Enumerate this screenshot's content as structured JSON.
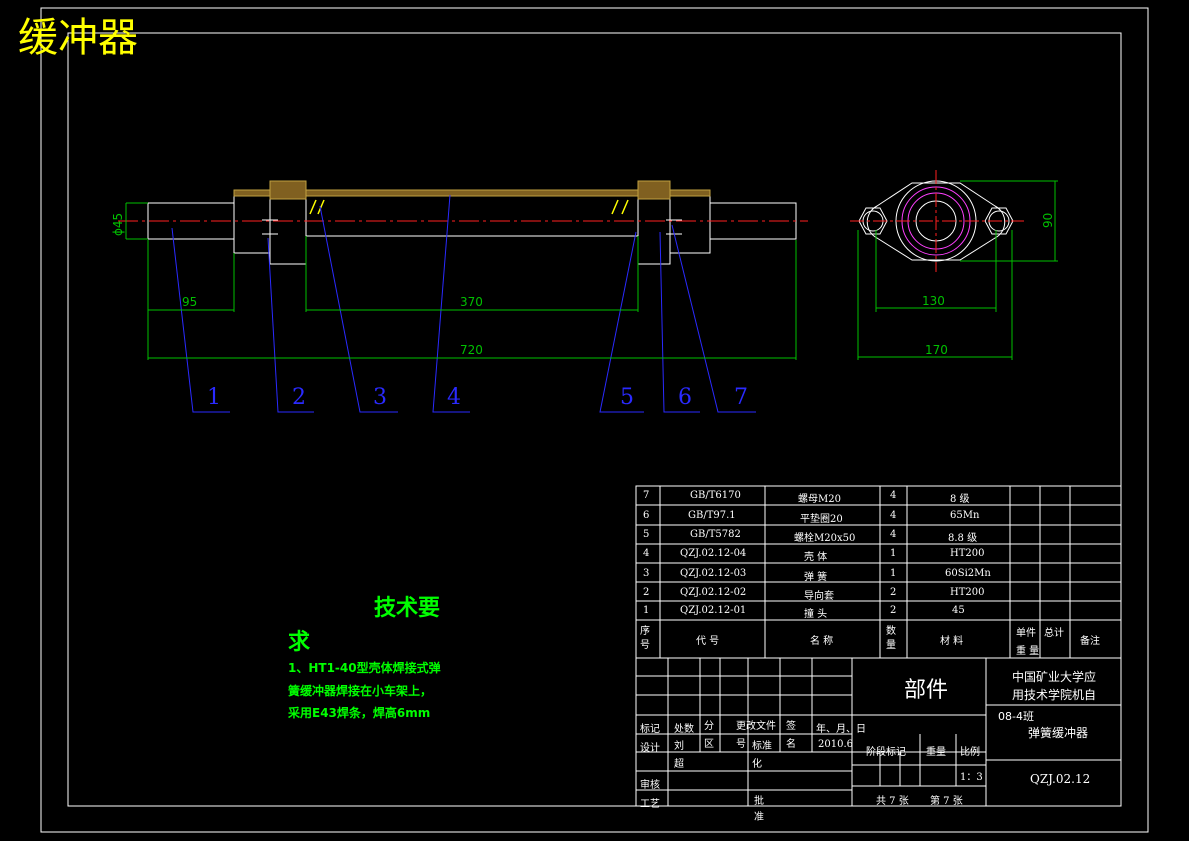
{
  "title": "缓冲器",
  "dimensions": {
    "dia45": "ϕ45",
    "d95": "95",
    "d370": "370",
    "d720": "720",
    "d130": "130",
    "d170": "170",
    "d90": "90"
  },
  "part_numbers": [
    "1",
    "2",
    "3",
    "4",
    "5",
    "6",
    "7"
  ],
  "tech_requirements": {
    "heading_line1": "技术要",
    "heading_line2": "求",
    "lines": [
      "1、HT1-40型壳体焊接式弹",
      "簧缓冲器焊接在小车架上，",
      "采用E43焊条，焊高6mm"
    ]
  },
  "parts_list": [
    {
      "no": "7",
      "code": "GB/T6170",
      "name": "螺母M20",
      "qty": "4",
      "material": "8 级"
    },
    {
      "no": "6",
      "code": "GB/T97.1",
      "name": "平垫圈20",
      "qty": "4",
      "material": "65Mn"
    },
    {
      "no": "5",
      "code": "GB/T5782",
      "name": "螺栓M20x50",
      "qty": "4",
      "material": "8.8 级"
    },
    {
      "no": "4",
      "code": "QZJ.02.12-04",
      "name": "壳 体",
      "qty": "1",
      "material": "HT200"
    },
    {
      "no": "3",
      "code": "QZJ.02.12-03",
      "name": "弹 簧",
      "qty": "1",
      "material": "60Si2Mn"
    },
    {
      "no": "2",
      "code": "QZJ.02.12-02",
      "name": "导向套",
      "qty": "2",
      "material": "HT200"
    },
    {
      "no": "1",
      "code": "QZJ.02.12-01",
      "name": "撞 头",
      "qty": "2",
      "material": "45"
    }
  ],
  "parts_header": {
    "no": "序号",
    "code": "代 号",
    "name": "名 称",
    "qty": "数量",
    "material": "材 料",
    "unit": "单件",
    "total": "总计",
    "weight": "重 量",
    "remark": "备注"
  },
  "title_block": {
    "part": "部件",
    "school_line1": "中国矿业大学应",
    "school_line2": "用技术学院机自",
    "class": "08-4班",
    "drawing_name": "弹簧缓冲器",
    "drawing_no": "QZJ.02.12",
    "mark": "标记",
    "count": "处数",
    "zone": "分 区",
    "change_doc": "更改文件 号",
    "sign": "签 名",
    "date_hdr": "年、月、日",
    "design": "设计",
    "designer": "刘 超",
    "standardize": "标准 化",
    "date": "2010.6",
    "stage": "阶段标记",
    "weight": "重量",
    "scale": "比例",
    "scale_value": "1：3",
    "review": "审核",
    "process": "工艺",
    "approve": "批 准",
    "sheets": "共 7 张",
    "sheet_no": "第 7 张"
  }
}
